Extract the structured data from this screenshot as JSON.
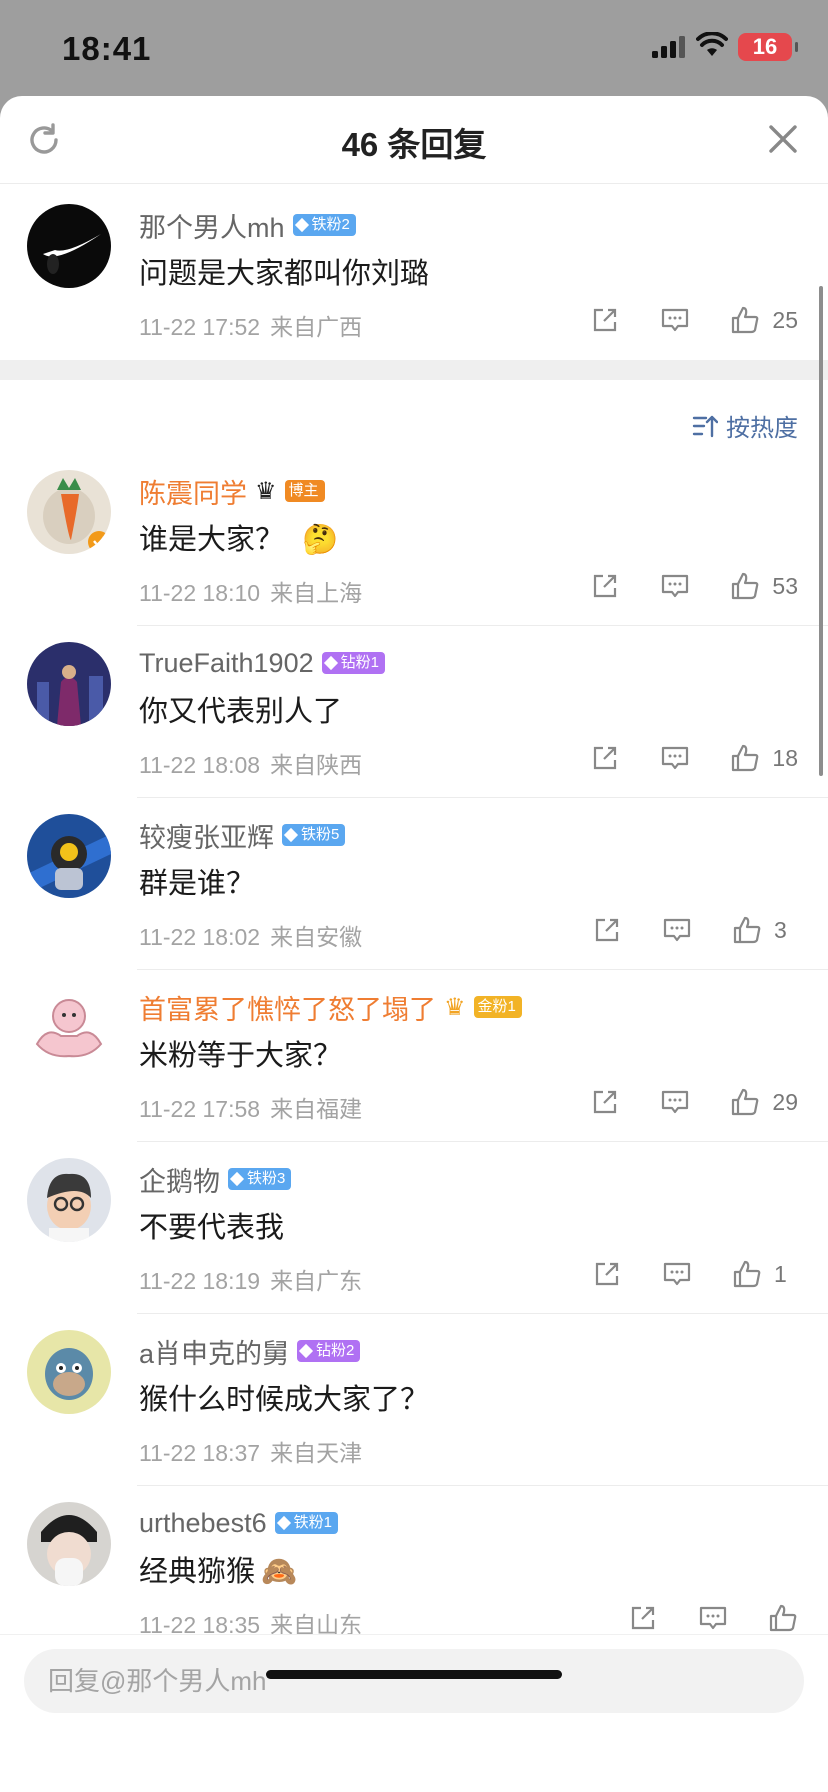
{
  "status": {
    "time": "18:41",
    "battery": "16"
  },
  "header": {
    "title": "46 条回复"
  },
  "sort": {
    "label": "按热度"
  },
  "comments": [
    {
      "user": "那个男人mh",
      "badge": "铁粉2",
      "text": "问题是大家都叫你刘璐",
      "date": "11-22 17:52",
      "location": "来自广西",
      "likes": "25"
    },
    {
      "user": "陈震同学",
      "badge": "博主",
      "text": "谁是大家？",
      "date": "11-22 18:10",
      "location": "来自上海",
      "likes": "53"
    },
    {
      "user": "TrueFaith1902",
      "badge": "钻粉1",
      "text": "你又代表别人了",
      "date": "11-22 18:08",
      "location": "来自陕西",
      "likes": "18"
    },
    {
      "user": "较瘦张亚辉",
      "badge": "铁粉5",
      "text": "群是谁？",
      "date": "11-22 18:02",
      "location": "来自安徽",
      "likes": "3"
    },
    {
      "user": "首富累了憔悴了怒了塌了",
      "badge": "金粉1",
      "text": "米粉等于大家？",
      "date": "11-22 17:58",
      "location": "来自福建",
      "likes": "29"
    },
    {
      "user": "企鹅物",
      "badge": "铁粉3",
      "text": "不要代表我",
      "date": "11-22 18:19",
      "location": "来自广东",
      "likes": "1"
    },
    {
      "user": "a肖申克的舅",
      "badge": "钻粉2",
      "text": "猴什么时候成大家了？",
      "date": "11-22 18:37",
      "location": "来自天津",
      "likes": ""
    },
    {
      "user": "urthebest6",
      "badge": "铁粉1",
      "text": "经典猕猴",
      "date": "11-22 18:35",
      "location": "来自山东",
      "likes": ""
    }
  ],
  "reply": {
    "placeholder": "回复@那个男人mh"
  },
  "colors": {
    "accent_orange": "#ef7d32",
    "link_blue": "#4e6fa3",
    "badge_blue": "#5aa7f0",
    "badge_purple": "#b071f3",
    "badge_gold": "#f2b326"
  },
  "icons": [
    "refresh-icon",
    "close-icon",
    "share-icon",
    "comment-icon",
    "like-icon",
    "sort-icon"
  ]
}
